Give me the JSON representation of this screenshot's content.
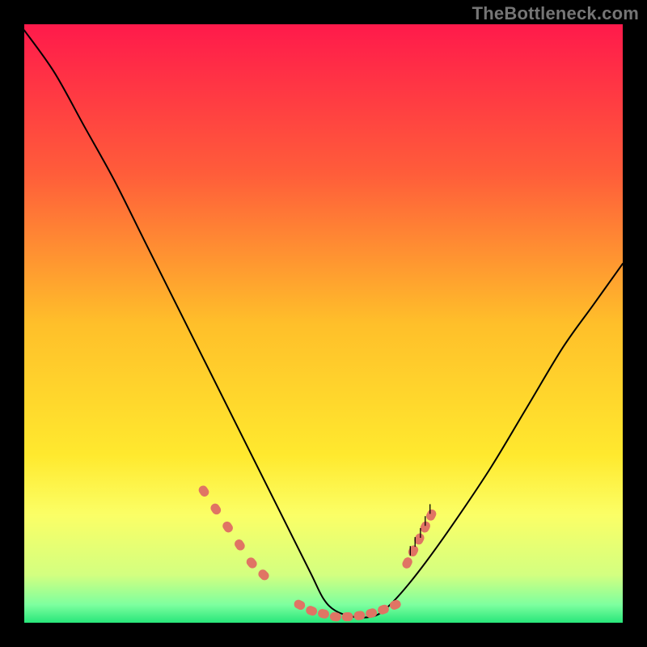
{
  "watermark": "TheBottleneck.com",
  "chart_data": {
    "type": "line",
    "title": "",
    "xlabel": "",
    "ylabel": "",
    "xlim": [
      0,
      100
    ],
    "ylim": [
      0,
      100
    ],
    "grid": false,
    "legend": false,
    "background_gradient": {
      "direction": "vertical",
      "stops": [
        {
          "pos": 0.0,
          "color": "#ff1a4b"
        },
        {
          "pos": 0.25,
          "color": "#ff5d3a"
        },
        {
          "pos": 0.5,
          "color": "#ffbf2a"
        },
        {
          "pos": 0.72,
          "color": "#ffe92e"
        },
        {
          "pos": 0.82,
          "color": "#fbff66"
        },
        {
          "pos": 0.92,
          "color": "#d3ff80"
        },
        {
          "pos": 0.97,
          "color": "#7dff9f"
        },
        {
          "pos": 1.0,
          "color": "#28e67a"
        }
      ]
    },
    "series": [
      {
        "name": "bottleneck-curve",
        "color": "#000000",
        "x": [
          0,
          5,
          10,
          15,
          20,
          25,
          30,
          35,
          40,
          45,
          48,
          50,
          52,
          55,
          58,
          60,
          63,
          67,
          72,
          78,
          84,
          90,
          95,
          100
        ],
        "values": [
          99,
          92,
          83,
          74,
          64,
          54,
          44,
          34,
          24,
          14,
          8,
          4,
          2,
          1,
          1,
          2,
          5,
          10,
          17,
          26,
          36,
          46,
          53,
          60
        ]
      },
      {
        "name": "highlight-dots-left",
        "type": "scatter",
        "color": "#e07464",
        "marker": "capsule",
        "x": [
          30,
          32,
          34,
          36,
          38,
          40
        ],
        "values": [
          22,
          19,
          16,
          13,
          10,
          8
        ]
      },
      {
        "name": "highlight-dots-bottom",
        "type": "scatter",
        "color": "#e07464",
        "marker": "capsule",
        "x": [
          46,
          48,
          50,
          52,
          54,
          56,
          58,
          60,
          62
        ],
        "values": [
          3,
          2,
          1.5,
          1,
          1,
          1.2,
          1.6,
          2.2,
          3
        ]
      },
      {
        "name": "highlight-dots-right",
        "type": "scatter",
        "color": "#e07464",
        "marker": "capsule",
        "x": [
          64,
          65,
          66,
          67,
          68
        ],
        "values": [
          10,
          12,
          14,
          16,
          18
        ]
      },
      {
        "name": "fine-ticks-right",
        "type": "scatter",
        "color": "#000000",
        "marker": "tick",
        "x": [
          64.5,
          65.3,
          66.2,
          67.0,
          67.8
        ],
        "values": [
          12,
          13.5,
          15,
          17,
          19
        ]
      }
    ]
  }
}
